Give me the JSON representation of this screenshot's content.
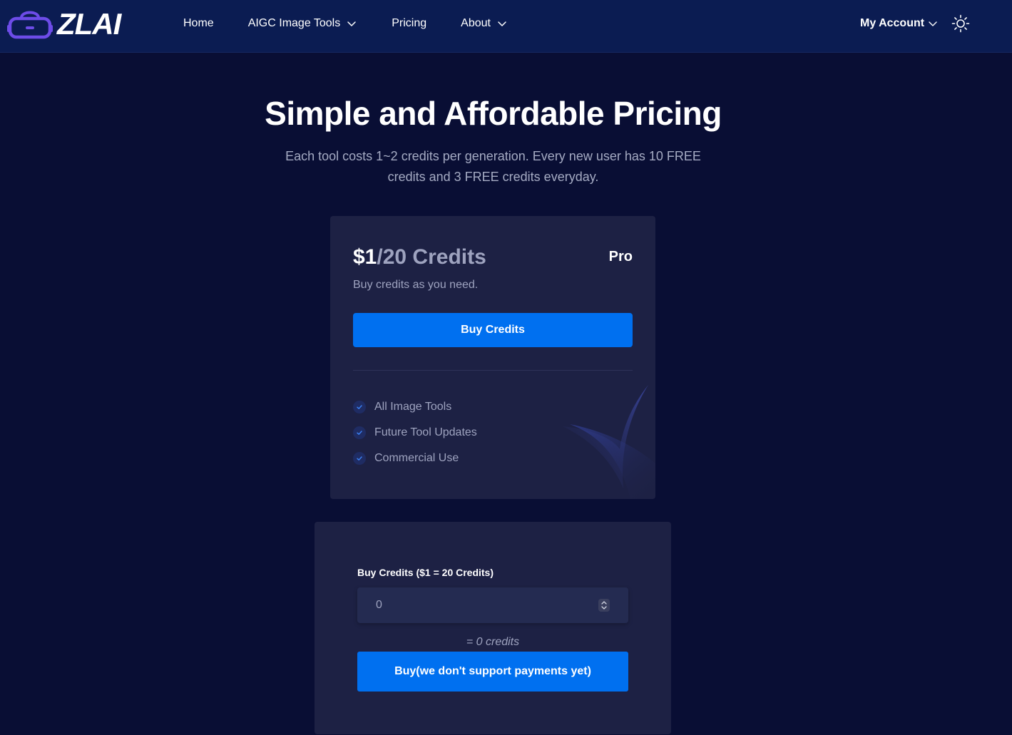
{
  "header": {
    "logo_text": "ZLAI",
    "nav": [
      {
        "label": "Home"
      },
      {
        "label": "AIGC Image Tools"
      },
      {
        "label": "Pricing"
      },
      {
        "label": "About"
      }
    ],
    "account_label": "My Account"
  },
  "hero": {
    "title": "Simple and Affordable Pricing",
    "subtitle": "Each tool costs 1~2 credits per generation. Every new user has 10 FREE credits and 3 FREE credits everyday."
  },
  "card": {
    "price_amount": "$1",
    "price_unit": "/20 Credits",
    "tier": "Pro",
    "description": "Buy credits as you need.",
    "button_label": "Buy Credits",
    "features": [
      "All Image Tools",
      "Future Tool Updates",
      "Commercial Use"
    ]
  },
  "buy_panel": {
    "label": "Buy Credits ($1 = 20 Credits)",
    "input_value": "0",
    "credits_result": "= 0 credits",
    "button_label": "Buy(we don't support payments yet)"
  },
  "colors": {
    "page_bg": "#090e34",
    "header_bg": "#0b1c52",
    "card_bg": "#1d2144",
    "primary": "#0070f0",
    "muted_text": "#9ea3bf",
    "logo_accent": "#6d4ce8"
  },
  "icons": {
    "logo": "vr-headset-icon",
    "nav_dropdown": "chevron-down-icon",
    "theme_toggle": "sun-icon",
    "feature": "check-icon",
    "stepper": "up-down-arrows-icon"
  }
}
